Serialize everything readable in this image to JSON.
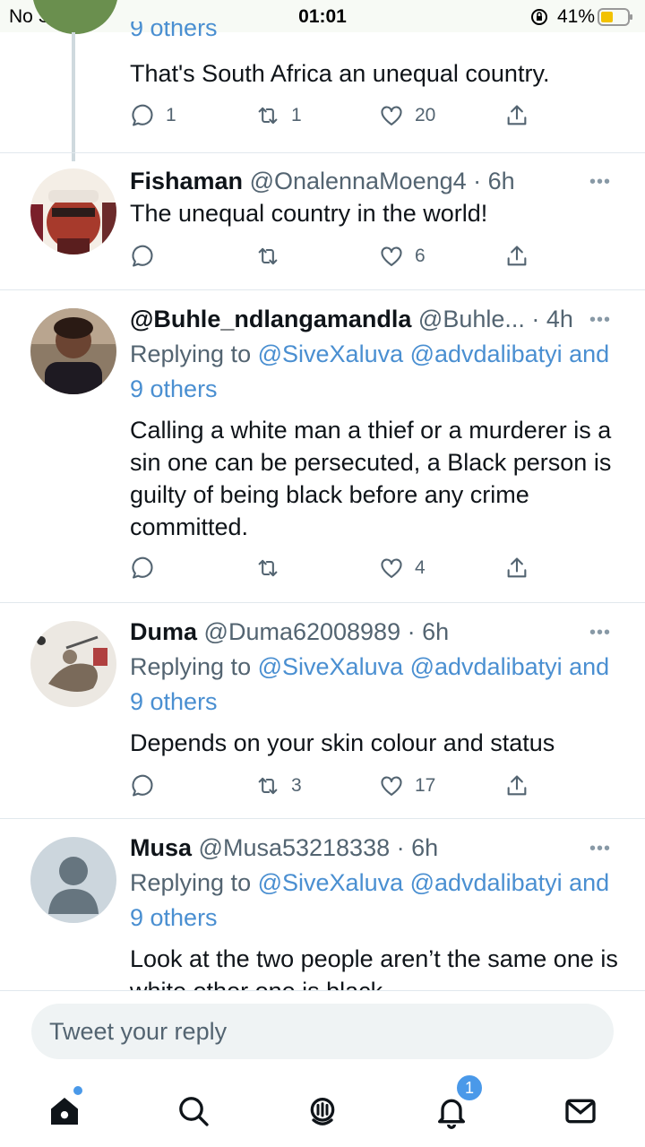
{
  "status_bar": {
    "carrier": "No SIM",
    "time": "01:01",
    "battery": "41%"
  },
  "partial_tweet": {
    "reply_tail": "9 others",
    "text": "That's South Africa an unequal country.",
    "replies": "1",
    "retweets": "1",
    "likes": "20"
  },
  "tweets": [
    {
      "name": "Fishaman",
      "handle": "@OnalennaMoeng4",
      "time": "· 6h",
      "text": "The unequal country in the world!",
      "replies": "",
      "retweets": "",
      "likes": "6"
    },
    {
      "name": "@Buhle_ndlangamandla",
      "handle": "@Buhle...",
      "time": "· 4h",
      "replying_label": "Replying to",
      "replying_to": "@SiveXaluva @advdalibatyi and 9 others",
      "text": "Calling a white man a thief or a murderer is a sin one can be persecuted, a Black person is guilty of being black before any crime committed.",
      "replies": "",
      "retweets": "",
      "likes": "4"
    },
    {
      "name": "Duma",
      "handle": "@Duma62008989",
      "time": "· 6h",
      "replying_label": "Replying to",
      "replying_to": "@SiveXaluva @advdalibatyi and 9 others",
      "text": "Depends on your skin colour and status",
      "replies": "",
      "retweets": "3",
      "likes": "17"
    },
    {
      "name": "Musa",
      "handle": "@Musa53218338",
      "time": "· 6h",
      "replying_label": "Replying to",
      "replying_to": "@SiveXaluva @advdalibatyi and 9 others",
      "text": "Look at the two people aren’t the same one is white other one is black"
    }
  ],
  "more_label": "•••",
  "reply_composer": {
    "placeholder": "Tweet your reply"
  },
  "tab_bar": {
    "notifications_count": "1"
  },
  "colors": {
    "link": "#4a8fd1",
    "accent": "#4a99e9",
    "secondary_text": "#536471"
  }
}
